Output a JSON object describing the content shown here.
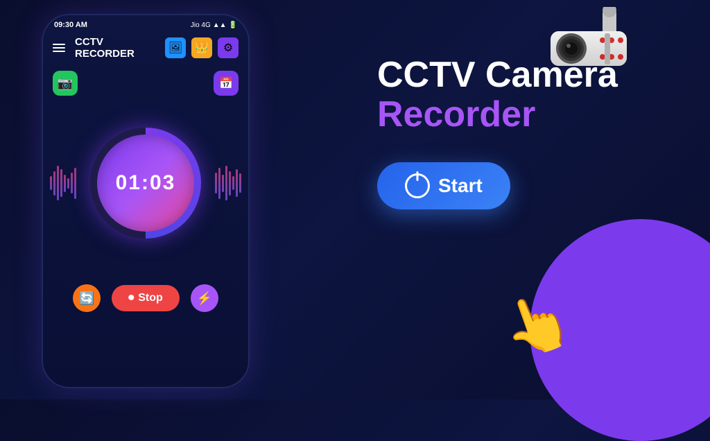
{
  "app": {
    "title": "CCTV RECORDER",
    "promo_title_line1": "CCTV Camera",
    "promo_title_line2": "Recorder",
    "start_button_label": "Start",
    "stop_button_label": "Stop"
  },
  "status_bar": {
    "time": "09:30 AM",
    "carrier": "Jio 4G"
  },
  "timer": {
    "display": "01:03"
  },
  "toolbar_icons": {
    "gallery": "🖼",
    "crown": "👑",
    "settings": "⚙"
  },
  "colors": {
    "accent_purple": "#7c3aed",
    "accent_blue": "#3b82f6",
    "stop_red": "#ef4444",
    "orange": "#f97316",
    "green": "#22c55e"
  }
}
